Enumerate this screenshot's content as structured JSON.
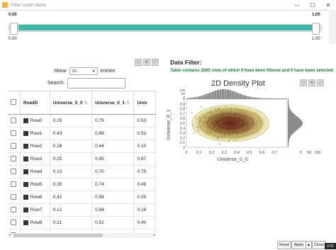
{
  "window": {
    "title": "Filter count demo",
    "minimize": "—",
    "maximize": "☐",
    "close": "✕"
  },
  "slider": {
    "min_label": "0.00",
    "max_label": "1.00",
    "low_value": "0.00",
    "high_value": "1.00",
    "low_fraction": 0.0,
    "high_fraction": 1.0,
    "fill_color": "#3fb8a7"
  },
  "table_panel": {
    "show_label": "Show",
    "entries_value": "10",
    "entries_label": "entries",
    "search_label": "Search:",
    "search_value": "",
    "search_placeholder": "",
    "columns": [
      "RowID",
      "Universe_0_0",
      "Universe_0_1",
      "Univ"
    ],
    "rows": [
      [
        "Row0",
        "0.25",
        "0.79",
        "0.53"
      ],
      [
        "Row1",
        "0.43",
        "0.89",
        "0.52"
      ],
      [
        "Row2",
        "0.28",
        "0.44",
        "0.10"
      ],
      [
        "Row3",
        "0.25",
        "0.85",
        "0.87"
      ],
      [
        "Row4",
        "0.13",
        "0.70",
        "0.75"
      ],
      [
        "Row5",
        "0.35",
        "0.74",
        "0.49"
      ],
      [
        "Row6",
        "0.42",
        "0.58",
        "0.25"
      ],
      [
        "Row7",
        "0.12",
        "0.84",
        "0.24"
      ],
      [
        "Row8",
        "0.21",
        "0.52",
        "0.40"
      ],
      [
        "Row9",
        "0.21",
        "0.84",
        "0.33"
      ]
    ]
  },
  "data_filter": {
    "title": "Data Filter:",
    "status": "Table contains 2500 rows of which 0 have been filtered and 0 have been selected"
  },
  "chart_data": {
    "type": "scatter",
    "title": "2D Density Plot",
    "xlabel": "Universe_0_0",
    "ylabel": "Universe_0_1",
    "xlim": [
      0,
      0.8
    ],
    "ylim": [
      0,
      1.0
    ],
    "x_ticks": [
      "0",
      "0.1",
      "0.2",
      "0.3",
      "0.4",
      "0.5",
      "0.6",
      "0.7"
    ],
    "y_ticks": [
      "0",
      "0.1",
      "0.2",
      "0.3",
      "0.4",
      "0.5",
      "0.6",
      "0.7",
      "0.8",
      "0.9",
      "1"
    ],
    "top_hist_ticks": [
      "0",
      "50",
      "100"
    ],
    "right_hist_ticks": [
      "0",
      "50",
      "100"
    ],
    "density_center": {
      "x": 0.3,
      "y": 0.5
    },
    "colors": {
      "point": "#555555",
      "density_low": "#8a7a1f",
      "density_high": "#5b1414",
      "histogram": "#8c8c8c"
    }
  },
  "buttons": {
    "reset": "Reset",
    "apply": "Apply",
    "apply_dropdown": "▲",
    "close": "Close"
  },
  "timer": "0:00"
}
